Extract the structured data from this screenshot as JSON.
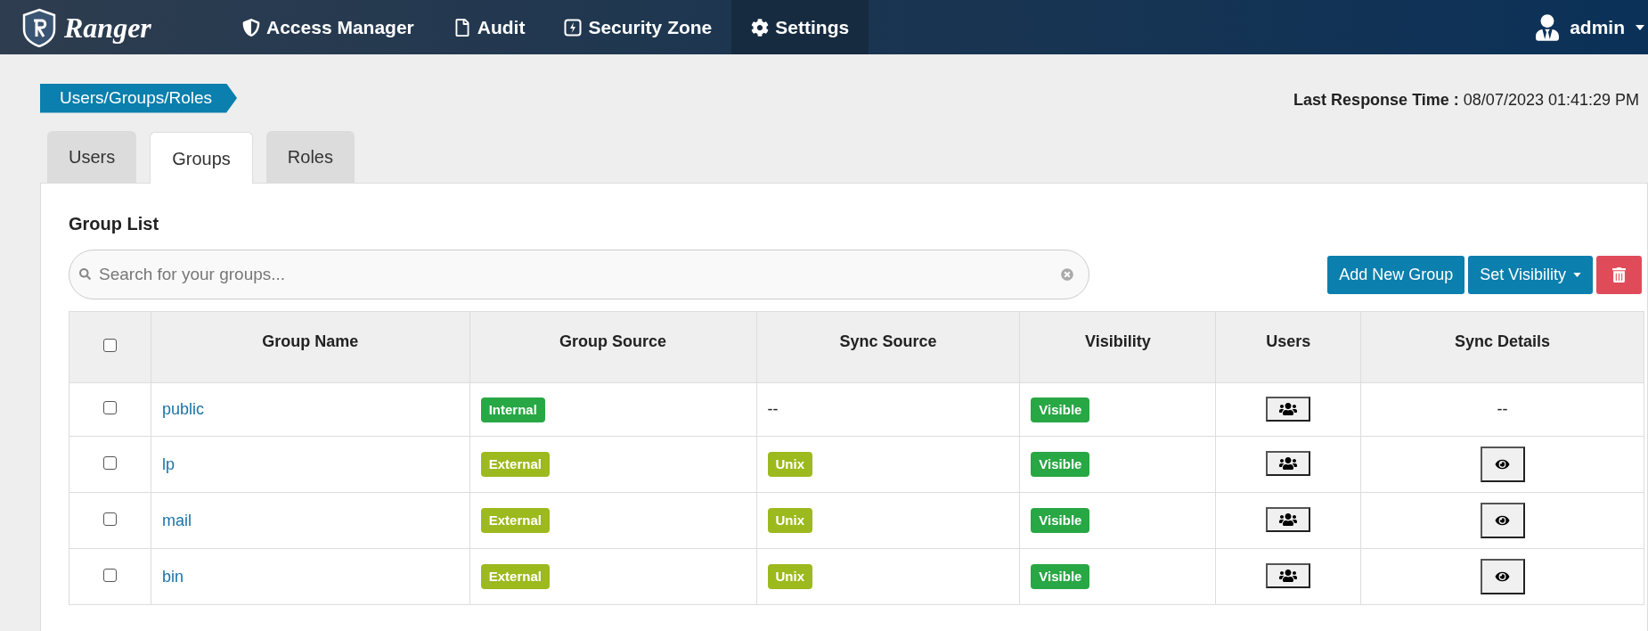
{
  "brand": "Ranger",
  "nav": [
    {
      "label": "Access Manager",
      "kind": "shield",
      "selected": false
    },
    {
      "label": "Audit",
      "kind": "file",
      "selected": false
    },
    {
      "label": "Security Zone",
      "kind": "bolt",
      "selected": false
    },
    {
      "label": "Settings",
      "kind": "gear",
      "selected": true
    }
  ],
  "user": "admin",
  "breadcrumb": "Users/Groups/Roles",
  "last_response": {
    "label": "Last Response Time :",
    "value": "08/07/2023 01:41:29 PM"
  },
  "tabs": [
    {
      "label": "Users",
      "selected": false
    },
    {
      "label": "Groups",
      "selected": true
    },
    {
      "label": "Roles",
      "selected": false
    }
  ],
  "heading": "Group List",
  "search": {
    "placeholder": "Search for your groups..."
  },
  "buttons": [
    {
      "kind": "primary",
      "label": "Add New Group"
    },
    {
      "kind": "dropdown",
      "label": "Set Visibility"
    },
    {
      "kind": "delete"
    }
  ],
  "table": {
    "columns": [
      "Group Name",
      "Group Source",
      "Sync Source",
      "Visibility",
      "Users",
      "Sync Details"
    ],
    "header_checked": false,
    "rows": [
      {
        "checked": false,
        "name": "public",
        "source": {
          "label": "Internal",
          "color": "#28a745"
        },
        "sync_source": {
          "kind": "text",
          "label": "--"
        },
        "visibility": "Visible",
        "sync_details": {
          "kind": "text",
          "label": "--"
        }
      },
      {
        "checked": false,
        "name": "lp",
        "source": {
          "label": "External",
          "color": "#9cb91e"
        },
        "sync_source": {
          "kind": "badge",
          "label": "Unix"
        },
        "visibility": "Visible",
        "sync_details": {
          "kind": "view"
        }
      },
      {
        "checked": false,
        "name": "mail",
        "source": {
          "label": "External",
          "color": "#9cb91e"
        },
        "sync_source": {
          "kind": "badge",
          "label": "Unix"
        },
        "visibility": "Visible",
        "sync_details": {
          "kind": "view"
        }
      },
      {
        "checked": false,
        "name": "bin",
        "source": {
          "label": "External",
          "color": "#9cb91e"
        },
        "sync_source": {
          "kind": "badge",
          "label": "Unix"
        },
        "visibility": "Visible",
        "sync_details": {
          "kind": "view"
        }
      }
    ]
  }
}
